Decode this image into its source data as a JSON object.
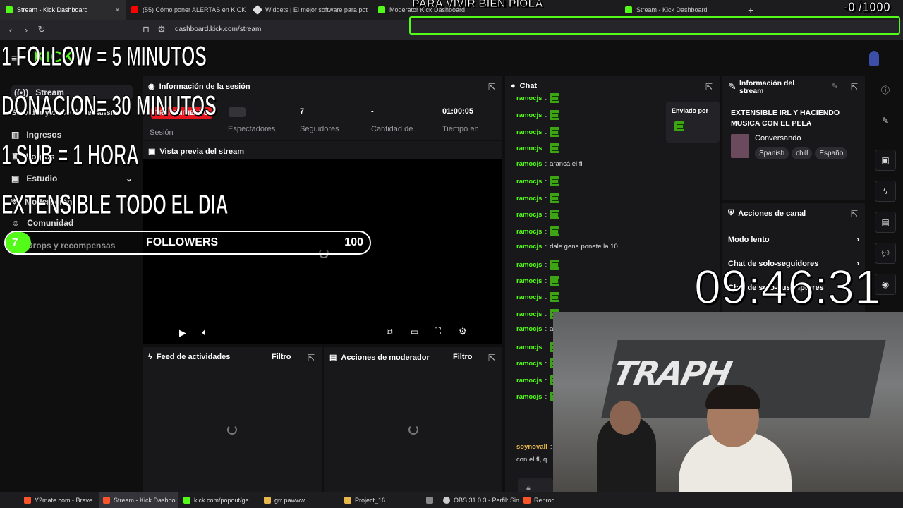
{
  "browser": {
    "tabs": [
      {
        "label": "Stream - Kick Dashboard",
        "color": "#53fc18"
      },
      {
        "label": "(55) Cómo poner ALERTAS en KICK -",
        "color": "#ff0000"
      },
      {
        "label": "Widgets | El mejor software para pot",
        "color": "#dddddd"
      },
      {
        "label": "Moderator Kick Dashboard",
        "color": "#53fc18"
      },
      {
        "label": "Stream - Kick Dashboard",
        "color": "#53fc18"
      }
    ],
    "url": "dashboard.kick.com/stream"
  },
  "overlay": {
    "top_banner": "PARA VIVIR BIEN PIOLA",
    "top_right": "-0  /1000",
    "line1": "1 FOLLOW = 5 MINUTOS",
    "line2": "DONACION= 30 MINUTOS",
    "line3": "1 SUB = 1 HORA",
    "line4": "EXTENSIBLE TODO EL DIA",
    "goal_count": "7",
    "goal_label": "FOLLOWERS",
    "goal_target": "100",
    "goal_fraction": 0.07,
    "clock": "09:46:31"
  },
  "sidebar": {
    "logo": "KICK",
    "items": [
      {
        "label": "Stream"
      },
      {
        "label": "Servidor y clave de retransm"
      },
      {
        "label": "Ingresos"
      },
      {
        "label": "Logros"
      },
      {
        "label": "Estudio"
      },
      {
        "label": "Moderación"
      },
      {
        "label": "Comunidad"
      },
      {
        "label": "Drops y recompensas"
      }
    ]
  },
  "session": {
    "title": "Información de la sesión",
    "status_badge": "TRANSMITIENDO",
    "session_label": "Sesión",
    "stats": [
      {
        "value": "",
        "label": "Espectadores"
      },
      {
        "value": "7",
        "label": "Seguidores"
      },
      {
        "value": "-",
        "label": "Cantidad de"
      },
      {
        "value": "01:00:05",
        "label": "Tiempo en"
      }
    ]
  },
  "preview": {
    "title": "Vista previa del stream"
  },
  "feed": {
    "title": "Feed de actividades",
    "filter": "Filtro"
  },
  "modactions": {
    "title": "Acciones de moderador",
    "filter": "Filtro"
  },
  "chat": {
    "title": "Chat",
    "pinned_label": "Enviado por",
    "messages": [
      {
        "user": "ramocjs",
        "text": "",
        "emote": true
      },
      {
        "user": "ramocjs",
        "text": "",
        "emote": true
      },
      {
        "user": "ramocjs",
        "text": "",
        "emote": true
      },
      {
        "user": "ramocjs",
        "text": "",
        "emote": true
      },
      {
        "user": "ramocjs",
        "text": "arancá el fl",
        "emote": false
      },
      {
        "user": "ramocjs",
        "text": "",
        "emote": true
      },
      {
        "user": "ramocjs",
        "text": "",
        "emote": true
      },
      {
        "user": "ramocjs",
        "text": "",
        "emote": true
      },
      {
        "user": "ramocjs",
        "text": "",
        "emote": true
      },
      {
        "user": "ramocjs",
        "text": "dale gena ponete la 10",
        "emote": false
      },
      {
        "user": "ramocjs",
        "text": "",
        "emote": true
      },
      {
        "user": "ramocjs",
        "text": "",
        "emote": true
      },
      {
        "user": "ramocjs",
        "text": "",
        "emote": true
      },
      {
        "user": "ramocjs",
        "text": "",
        "emote": true
      },
      {
        "user": "ramocjs",
        "text": "ar",
        "emote": false
      },
      {
        "user": "ramocjs",
        "text": "",
        "emote": true
      },
      {
        "user": "ramocjs",
        "text": "",
        "emote": true
      },
      {
        "user": "ramocjs",
        "text": "",
        "emote": true
      },
      {
        "user": "ramocjs",
        "text": "",
        "emote": true
      }
    ],
    "last_user": "soynovall",
    "last_text": "con el fl, q"
  },
  "streaminfo": {
    "title_line1": "Información del",
    "title_line2": "stream",
    "stream_title_line1": "EXTENSIBLE IRL Y HACIENDO",
    "stream_title_line2": "MUSICA CON EL PELA",
    "category": "Conversando",
    "tags": [
      "Spanish",
      "chill",
      "Españo"
    ]
  },
  "channel_actions": {
    "title": "Acciones de canal",
    "items": [
      {
        "label": "Modo lento"
      },
      {
        "label": "Chat de solo-seguidores"
      },
      {
        "label": "Chat de solo-suscriptores"
      }
    ]
  },
  "taskbar": {
    "items": [
      {
        "label": "Y2mate.com - Brave",
        "color": "#fb542b"
      },
      {
        "label": "Stream - Kick Dashbo...",
        "color": "#fb542b"
      },
      {
        "label": "kick.com/popout/ge...",
        "color": "#53fc18"
      },
      {
        "label": "grr pawww",
        "color": "#e8b84a"
      },
      {
        "label": "Project_16",
        "color": "#e8b84a"
      },
      {
        "label": "",
        "color": "#888888"
      },
      {
        "label": "OBS 31.0.3 - Perfil: Sin...",
        "color": "#cccccc"
      },
      {
        "label": "Reprod",
        "color": "#fb542b"
      }
    ]
  },
  "colors": {
    "accent": "#53fc18",
    "live": "#e5161d"
  }
}
